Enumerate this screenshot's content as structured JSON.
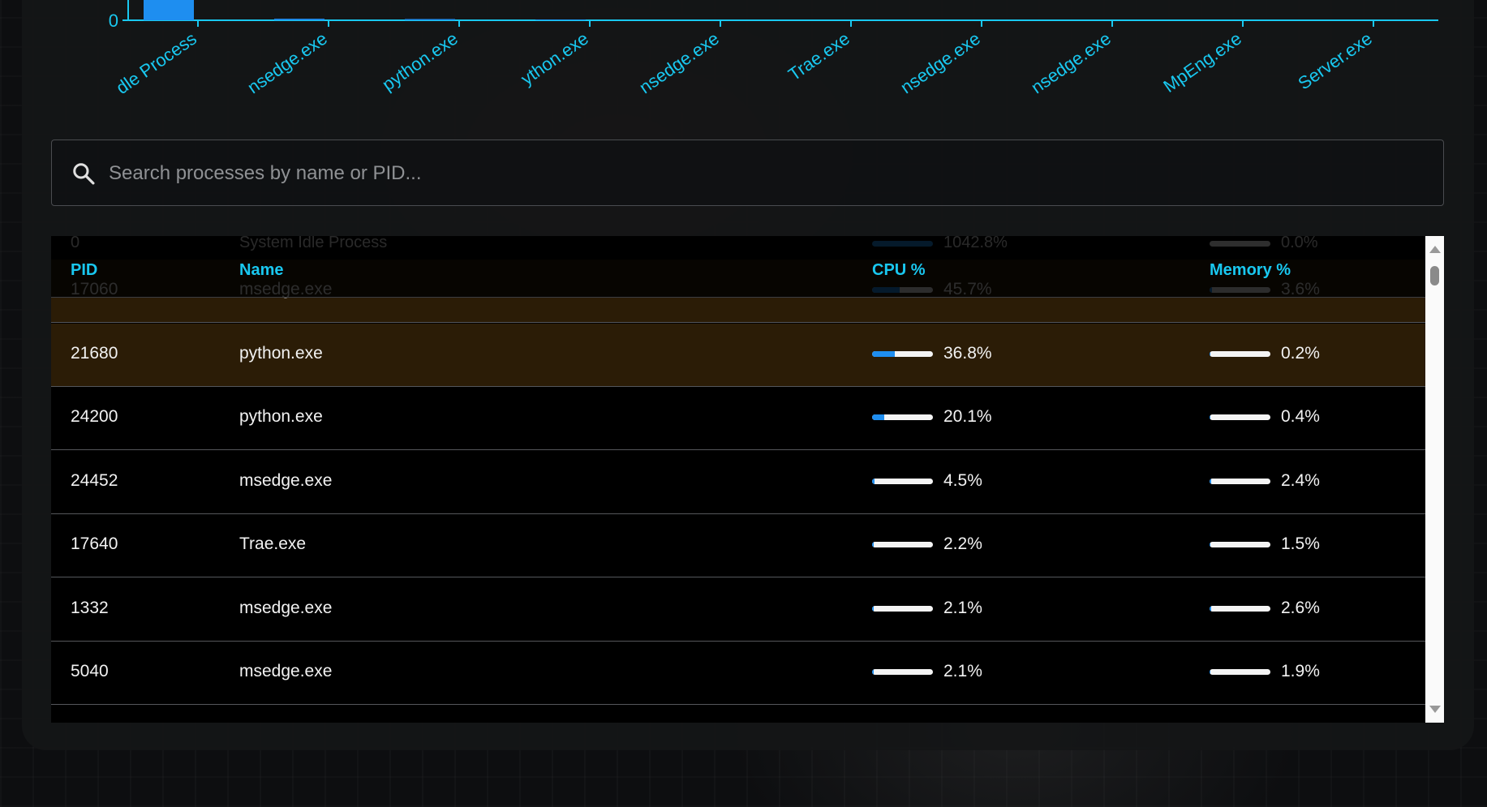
{
  "chart_data": {
    "type": "bar",
    "categories": [
      "System Idle Process",
      "msedge.exe",
      "python.exe",
      "python.exe",
      "msedge.exe",
      "Trae.exe",
      "msedge.exe",
      "msedge.exe",
      "MsMpEng.exe",
      "SearchServer.exe"
    ],
    "visible_tick_labels": [
      "dle Process",
      "nsedge.exe",
      "python.exe",
      "ython.exe",
      "nsedge.exe",
      "Trae.exe",
      "nsedge.exe",
      "nsedge.exe",
      "MpEng.exe",
      "Server.exe"
    ],
    "values": [
      1042.8,
      45.7,
      36.8,
      20.1,
      4.5,
      2.2,
      2.1,
      2.1,
      0,
      0
    ],
    "y_tick_label": "0",
    "colors": {
      "bar": "#1e8ef0",
      "axis": "#19c8f0"
    }
  },
  "search": {
    "placeholder": "Search processes by name or PID...",
    "icon": "search-icon"
  },
  "table": {
    "columns": [
      "PID",
      "Name",
      "CPU %",
      "Memory %"
    ],
    "partial_top_row": {
      "pid": "0",
      "name": "System Idle Process",
      "cpu": 1042.8,
      "cpu_label": "1042.8%",
      "mem": 0.0,
      "mem_label": "0.0%"
    },
    "rows": [
      {
        "pid": "17060",
        "name": "msedge.exe",
        "cpu": 45.7,
        "cpu_label": "45.7%",
        "mem": 3.6,
        "mem_label": "3.6%",
        "highlight": true
      },
      {
        "pid": "21680",
        "name": "python.exe",
        "cpu": 36.8,
        "cpu_label": "36.8%",
        "mem": 0.2,
        "mem_label": "0.2%",
        "highlight": true
      },
      {
        "pid": "24200",
        "name": "python.exe",
        "cpu": 20.1,
        "cpu_label": "20.1%",
        "mem": 0.4,
        "mem_label": "0.4%",
        "highlight": false
      },
      {
        "pid": "24452",
        "name": "msedge.exe",
        "cpu": 4.5,
        "cpu_label": "4.5%",
        "mem": 2.4,
        "mem_label": "2.4%",
        "highlight": false
      },
      {
        "pid": "17640",
        "name": "Trae.exe",
        "cpu": 2.2,
        "cpu_label": "2.2%",
        "mem": 1.5,
        "mem_label": "1.5%",
        "highlight": false
      },
      {
        "pid": "1332",
        "name": "msedge.exe",
        "cpu": 2.1,
        "cpu_label": "2.1%",
        "mem": 2.6,
        "mem_label": "2.6%",
        "highlight": false
      },
      {
        "pid": "5040",
        "name": "msedge.exe",
        "cpu": 2.1,
        "cpu_label": "2.1%",
        "mem": 1.9,
        "mem_label": "1.9%",
        "highlight": false
      }
    ],
    "colors": {
      "header": "#19c8f0",
      "highlight_row": "#2b1c06",
      "bar_fill": "#1e8ef0"
    }
  }
}
